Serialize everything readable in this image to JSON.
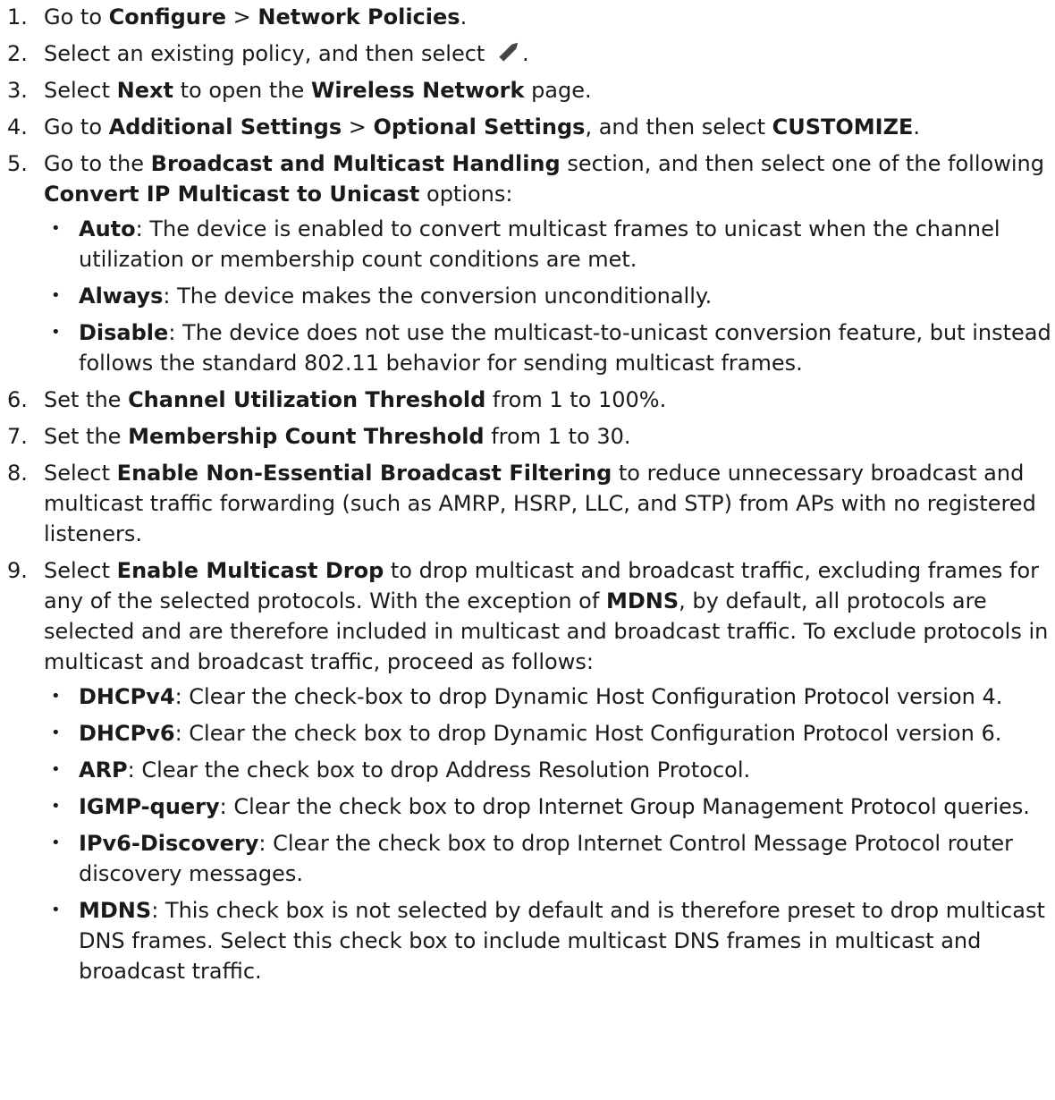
{
  "steps": [
    {
      "number": "1.",
      "parts": [
        {
          "text": "Go to ",
          "bold": false
        },
        {
          "text": "Configure",
          "bold": true
        },
        {
          "text": " > ",
          "bold": false
        },
        {
          "text": "Network Policies",
          "bold": true
        },
        {
          "text": ".",
          "bold": false
        }
      ]
    },
    {
      "number": "2.",
      "parts": [
        {
          "text": "Select an existing policy, and then select ",
          "bold": false
        },
        {
          "icon": "pencil-icon"
        },
        {
          "text": ".",
          "bold": false
        }
      ]
    },
    {
      "number": "3.",
      "parts": [
        {
          "text": "Select ",
          "bold": false
        },
        {
          "text": "Next",
          "bold": true
        },
        {
          "text": " to open the ",
          "bold": false
        },
        {
          "text": "Wireless Network",
          "bold": true
        },
        {
          "text": " page.",
          "bold": false
        }
      ]
    },
    {
      "number": "4.",
      "parts": [
        {
          "text": "Go to ",
          "bold": false
        },
        {
          "text": "Additional Settings",
          "bold": true
        },
        {
          "text": " > ",
          "bold": false
        },
        {
          "text": "Optional Settings",
          "bold": true
        },
        {
          "text": ", and then select ",
          "bold": false
        },
        {
          "text": "CUSTOMIZE",
          "bold": true
        },
        {
          "text": ".",
          "bold": false
        }
      ]
    },
    {
      "number": "5.",
      "parts": [
        {
          "text": "Go to the ",
          "bold": false
        },
        {
          "text": "Broadcast and Multicast Handling",
          "bold": true
        },
        {
          "text": " section, and then select one of the following ",
          "bold": false
        },
        {
          "text": "Convert IP Multicast to Unicast",
          "bold": true
        },
        {
          "text": " options:",
          "bold": false
        }
      ],
      "subitems": [
        {
          "parts": [
            {
              "text": "Auto",
              "bold": true
            },
            {
              "text": ": The device is enabled to convert multicast frames to unicast when the channel utilization or membership count conditions are met.",
              "bold": false
            }
          ]
        },
        {
          "parts": [
            {
              "text": "Always",
              "bold": true
            },
            {
              "text": ": The device makes the conversion unconditionally.",
              "bold": false
            }
          ]
        },
        {
          "parts": [
            {
              "text": "Disable",
              "bold": true
            },
            {
              "text": ": The device does not use the multicast-to-unicast conversion feature, but instead follows the standard 802.11 behavior for sending multicast frames.",
              "bold": false
            }
          ]
        }
      ]
    },
    {
      "number": "6.",
      "parts": [
        {
          "text": "Set the ",
          "bold": false
        },
        {
          "text": "Channel Utilization Threshold",
          "bold": true
        },
        {
          "text": " from 1 to 100%.",
          "bold": false
        }
      ]
    },
    {
      "number": "7.",
      "parts": [
        {
          "text": "Set the ",
          "bold": false
        },
        {
          "text": "Membership Count Threshold",
          "bold": true
        },
        {
          "text": " from 1 to 30.",
          "bold": false
        }
      ]
    },
    {
      "number": "8.",
      "parts": [
        {
          "text": "Select ",
          "bold": false
        },
        {
          "text": "Enable Non-Essential Broadcast Filtering",
          "bold": true
        },
        {
          "text": " to reduce unnecessary broadcast and multicast traffic forwarding (such as AMRP, HSRP, LLC, and STP) from APs with no registered listeners.",
          "bold": false
        }
      ]
    },
    {
      "number": "9.",
      "parts": [
        {
          "text": "Select ",
          "bold": false
        },
        {
          "text": "Enable Multicast Drop",
          "bold": true
        },
        {
          "text": " to drop multicast and broadcast traffic, excluding frames for any of the selected protocols. With the exception of ",
          "bold": false
        },
        {
          "text": "MDNS",
          "bold": true
        },
        {
          "text": ", by default, all protocols are selected and are therefore included in multicast and broadcast traffic. To exclude protocols in multicast and broadcast traffic, proceed as follows:",
          "bold": false
        }
      ],
      "subitems": [
        {
          "parts": [
            {
              "text": "DHCPv4",
              "bold": true
            },
            {
              "text": ": Clear the check-box to drop Dynamic Host Configuration Protocol version 4.",
              "bold": false
            }
          ]
        },
        {
          "parts": [
            {
              "text": "DHCPv6",
              "bold": true
            },
            {
              "text": ": Clear the check box to drop Dynamic Host Configuration Protocol version 6.",
              "bold": false
            }
          ]
        },
        {
          "parts": [
            {
              "text": "ARP",
              "bold": true
            },
            {
              "text": ": Clear the check box to drop Address Resolution Protocol.",
              "bold": false
            }
          ]
        },
        {
          "parts": [
            {
              "text": "IGMP-query",
              "bold": true
            },
            {
              "text": ": Clear the check box to drop Internet Group Management Protocol queries.",
              "bold": false
            }
          ]
        },
        {
          "parts": [
            {
              "text": "IPv6-Discovery",
              "bold": true
            },
            {
              "text": ": Clear the check box to drop Internet Control Message Protocol router discovery messages.",
              "bold": false
            }
          ]
        },
        {
          "parts": [
            {
              "text": "MDNS",
              "bold": true
            },
            {
              "text": ": This check box is not selected by default and is therefore preset to drop multicast DNS frames. Select this check box to ",
              "bold": false
            },
            {
              "text": "include",
              "bold": false
            },
            {
              "text": " multicast DNS frames in multicast and broadcast traffic.",
              "bold": false
            }
          ]
        }
      ]
    }
  ],
  "bullet_char": "•",
  "text_color": "#1a1a1a",
  "icon_color": "#444444"
}
